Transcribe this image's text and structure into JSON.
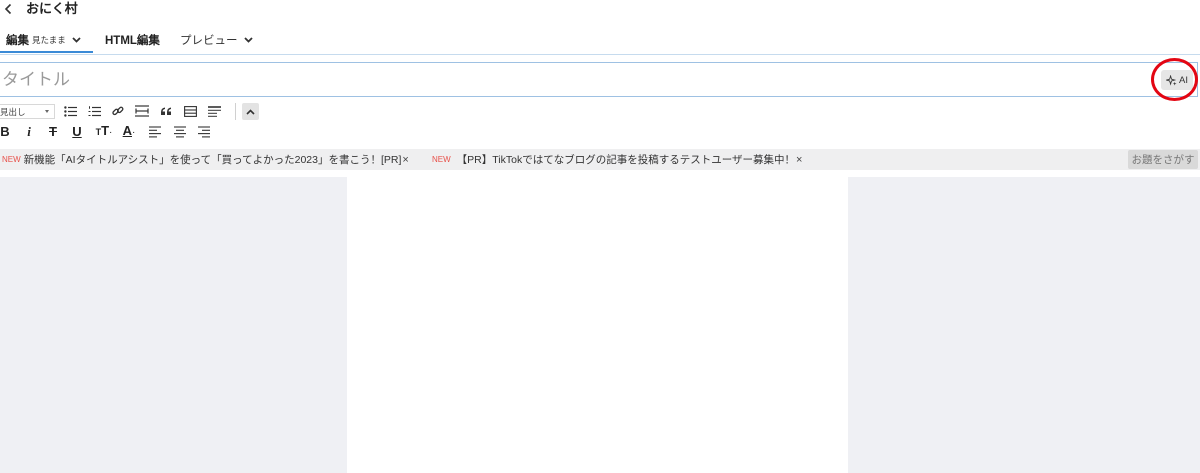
{
  "header": {
    "title": "おにく村"
  },
  "tabs": [
    {
      "label": "編集",
      "sublabel": "見たまま",
      "active": true
    },
    {
      "label": "HTML編集",
      "active": false
    },
    {
      "label": "プレビュー",
      "active": false
    }
  ],
  "title_input": {
    "placeholder": "タイトル",
    "value": ""
  },
  "ai_button": {
    "label": "AI",
    "icon": "sparkle-icon"
  },
  "toolbar": {
    "heading_select": {
      "selected": "見出し"
    },
    "row1_icons": [
      "bulleted-list-icon",
      "numbered-list-icon",
      "link-icon",
      "horizontal-rule-icon",
      "quote-icon",
      "table-icon",
      "paragraph-icon",
      "chevron-up-icon"
    ],
    "row2": [
      {
        "icon": "bold-icon",
        "glyph": "B"
      },
      {
        "icon": "italic-icon",
        "glyph": "i"
      },
      {
        "icon": "strikethrough-icon",
        "glyph": "T"
      },
      {
        "icon": "underline-icon",
        "glyph": "U"
      },
      {
        "icon": "font-size-icon",
        "glyph_small": "T",
        "glyph": "T",
        "dropdown_mark": "·"
      },
      {
        "icon": "text-color-icon",
        "glyph": "A",
        "dropdown_mark": "·"
      },
      {
        "icon": "align-left-icon"
      },
      {
        "icon": "align-center-icon"
      },
      {
        "icon": "align-right-icon"
      }
    ]
  },
  "notices": [
    {
      "badge": "NEW",
      "text": "新機能「AIタイトルアシスト」を使って「買ってよかった2023」を書こう！[PR]",
      "close": "×"
    },
    {
      "badge": "NEW",
      "text": "【PR】TikTokではてなブログの記事を投稿するテストユーザー募集中！",
      "close": "×"
    }
  ],
  "topic_button": {
    "label": "お題をさがす"
  },
  "colors": {
    "accent": "#3b8ad6",
    "badge_new": "#e8514a",
    "highlight_circle": "#e30613",
    "editor_bg": "#eff0f4",
    "notice_bg": "#efeff0"
  }
}
